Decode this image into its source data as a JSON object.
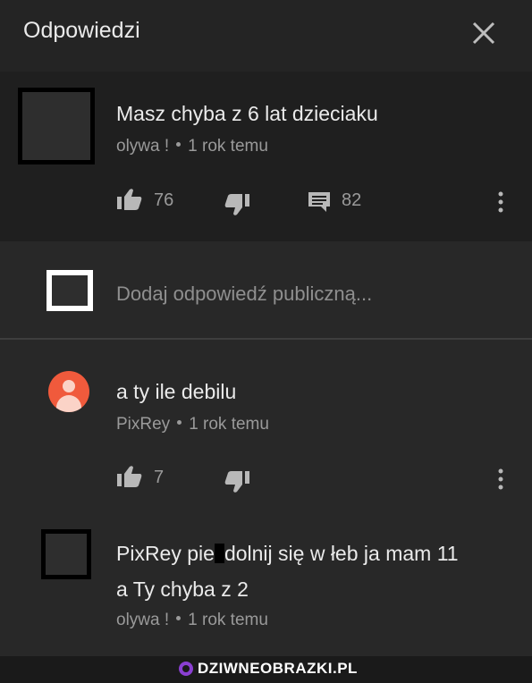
{
  "header": {
    "title": "Odpowiedzi",
    "close_icon": "close-icon"
  },
  "top_comment": {
    "text": "Masz chyba z 6 lat dzieciaku",
    "author": "olywa !",
    "time": "1 rok temu",
    "likes": "76",
    "replies": "82"
  },
  "reply_box": {
    "placeholder": "Dodaj odpowiedź publiczną..."
  },
  "reply1": {
    "text": "a ty ile debilu",
    "author": "PixRey",
    "time": "1 rok temu",
    "likes": "7"
  },
  "reply2": {
    "line1_start": "PixRey pie",
    "line1_end": "dolnij się w łeb ja mam 11",
    "line2": "a Ty chyba z 2",
    "author": "olywa !",
    "time": "1 rok temu"
  },
  "footer": {
    "watermark": "DZIWNEOBRAZKI.PL"
  },
  "colors": {
    "avatar_accent": "#f05a3c",
    "watermark_accent": "#8a3fd1"
  }
}
